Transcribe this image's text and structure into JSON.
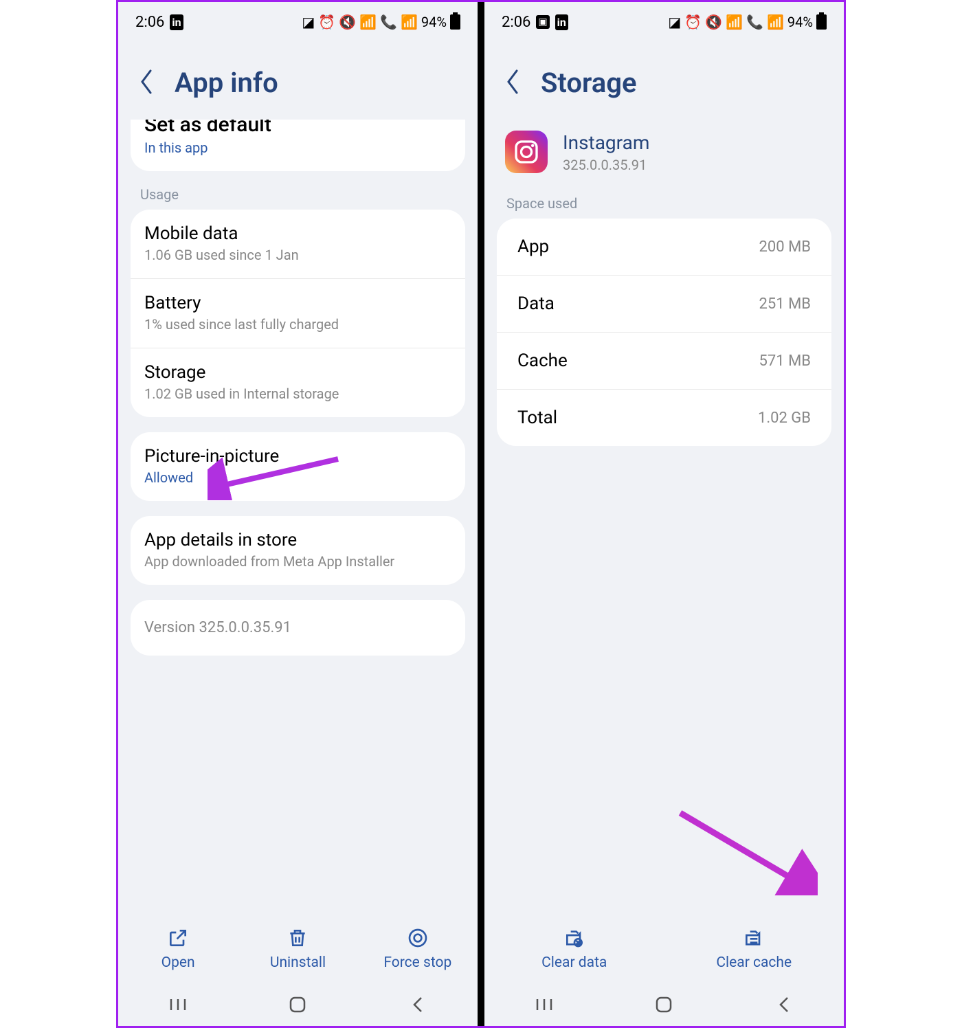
{
  "status": {
    "time": "2:06",
    "battery": "94%"
  },
  "left": {
    "title": "App info",
    "defaults": {
      "title": "Set as default",
      "sub": "In this app"
    },
    "usage_label": "Usage",
    "mobile": {
      "title": "Mobile data",
      "sub": "1.06 GB used since 1 Jan"
    },
    "battery": {
      "title": "Battery",
      "sub": "1% used since last fully charged"
    },
    "storage": {
      "title": "Storage",
      "sub": "1.02 GB used in Internal storage"
    },
    "pip": {
      "title": "Picture-in-picture",
      "sub": "Allowed"
    },
    "store": {
      "title": "App details in store",
      "sub": "App downloaded from Meta App Installer"
    },
    "version": "Version 325.0.0.35.91",
    "actions": {
      "open": "Open",
      "uninstall": "Uninstall",
      "forcestop": "Force stop"
    }
  },
  "right": {
    "title": "Storage",
    "app": {
      "name": "Instagram",
      "version": "325.0.0.35.91"
    },
    "space_label": "Space used",
    "rows": {
      "app": {
        "k": "App",
        "v": "200 MB"
      },
      "data": {
        "k": "Data",
        "v": "251 MB"
      },
      "cache": {
        "k": "Cache",
        "v": "571 MB"
      },
      "total": {
        "k": "Total",
        "v": "1.02 GB"
      }
    },
    "actions": {
      "cleardata": "Clear data",
      "clearcache": "Clear cache"
    }
  }
}
